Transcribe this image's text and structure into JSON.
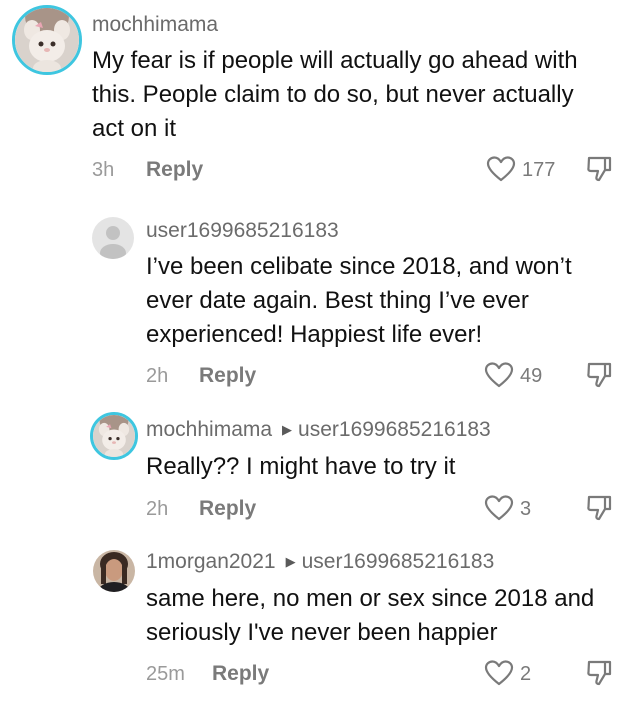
{
  "comments": [
    {
      "username": "mochhimama",
      "reply_to": "",
      "text": "My fear is if people will actually go ahead with this. People claim to do so, but never actually act on it",
      "age": "3h",
      "reply_label": "Reply",
      "likes": "177",
      "avatar": "plush-toy-avatar"
    },
    {
      "username": "user1699685216183",
      "reply_to": "",
      "text": "I’ve been celibate since 2018, and won’t ever date again. Best thing I’ve ever experienced! Happiest life ever!",
      "age": "2h",
      "reply_label": "Reply",
      "likes": "49",
      "avatar": "default-user-avatar"
    },
    {
      "username": "mochhimama",
      "reply_to": "user1699685216183",
      "text": "Really?? I might have to try it",
      "age": "2h",
      "reply_label": "Reply",
      "likes": "3",
      "avatar": "plush-toy-avatar"
    },
    {
      "username": "1morgan2021",
      "reply_to": "user1699685216183",
      "text": "same here, no men or sex since 2018 and seriously I've never been happier",
      "age": "25m",
      "reply_label": "Reply",
      "likes": "2",
      "avatar": "photo-avatar"
    }
  ],
  "icons": {
    "like": "heart-outline-icon",
    "dislike": "thumbs-down-icon",
    "reply_arrow": "triangle-right-icon"
  },
  "colors": {
    "story_ring": "#3ec6e0",
    "meta_gray": "#9a9a9a",
    "username_gray": "#6b6b6b"
  }
}
